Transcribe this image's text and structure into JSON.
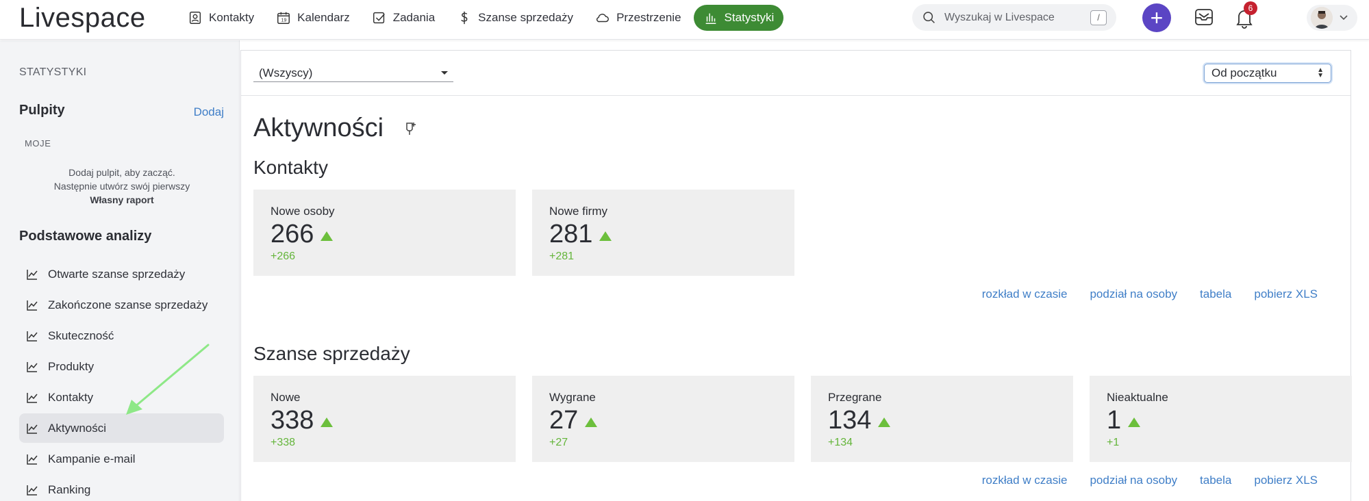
{
  "app": {
    "logo_text": "Livespace",
    "colors": {
      "accent": "#3d8b34",
      "plus": "#5b45c4",
      "link": "#3f7ec7",
      "positive": "#64b53a",
      "badge": "#c5212f"
    }
  },
  "topnav": {
    "items": [
      {
        "label": "Kontakty",
        "icon": "contact-card-icon"
      },
      {
        "label": "Kalendarz",
        "icon": "calendar-icon"
      },
      {
        "label": "Zadania",
        "icon": "checkbox-icon"
      },
      {
        "label": "Szanse sprzedaży",
        "icon": "dollar-icon"
      },
      {
        "label": "Przestrzenie",
        "icon": "cloud-icon"
      },
      {
        "label": "Statystyki",
        "icon": "bar-chart-icon",
        "active": true
      }
    ],
    "search_placeholder": "Wyszukaj w Livespace",
    "search_shortcut": "/",
    "plus_label": "+",
    "notifications_count": "6"
  },
  "sidebar": {
    "section_label": "STATYSTYKI",
    "dashboards_title": "Pulpity",
    "dashboards_add": "Dodaj",
    "my_label": "MOJE",
    "hint_line1": "Dodaj pulpit, aby zacząć.",
    "hint_line2": "Następnie utwórz swój pierwszy",
    "hint_line3": "Własny raport",
    "basic_title": "Podstawowe analizy",
    "items": [
      {
        "label": "Otwarte szanse sprzedaży"
      },
      {
        "label": "Zakończone szanse sprzedaży"
      },
      {
        "label": "Skuteczność"
      },
      {
        "label": "Produkty"
      },
      {
        "label": "Kontakty"
      },
      {
        "label": "Aktywności",
        "active": true
      },
      {
        "label": "Kampanie e-mail"
      },
      {
        "label": "Ranking"
      }
    ]
  },
  "main": {
    "owner_filter": "(Wszyscy)",
    "range_filter": "Od początku",
    "page_title": "Aktywności",
    "sections": [
      {
        "title": "Kontakty",
        "tiles": [
          {
            "label": "Nowe osoby",
            "value": "266",
            "delta": "+266"
          },
          {
            "label": "Nowe firmy",
            "value": "281",
            "delta": "+281"
          }
        ],
        "links": [
          "rozkład w czasie",
          "podział na osoby",
          "tabela",
          "pobierz XLS"
        ]
      },
      {
        "title": "Szanse sprzedaży",
        "tiles": [
          {
            "label": "Nowe",
            "value": "338",
            "delta": "+338"
          },
          {
            "label": "Wygrane",
            "value": "27",
            "delta": "+27"
          },
          {
            "label": "Przegrane",
            "value": "134",
            "delta": "+134"
          },
          {
            "label": "Nieaktualne",
            "value": "1",
            "delta": "+1"
          }
        ],
        "links": [
          "rozkład w czasie",
          "podział na osoby",
          "tabela",
          "pobierz XLS"
        ]
      }
    ]
  }
}
